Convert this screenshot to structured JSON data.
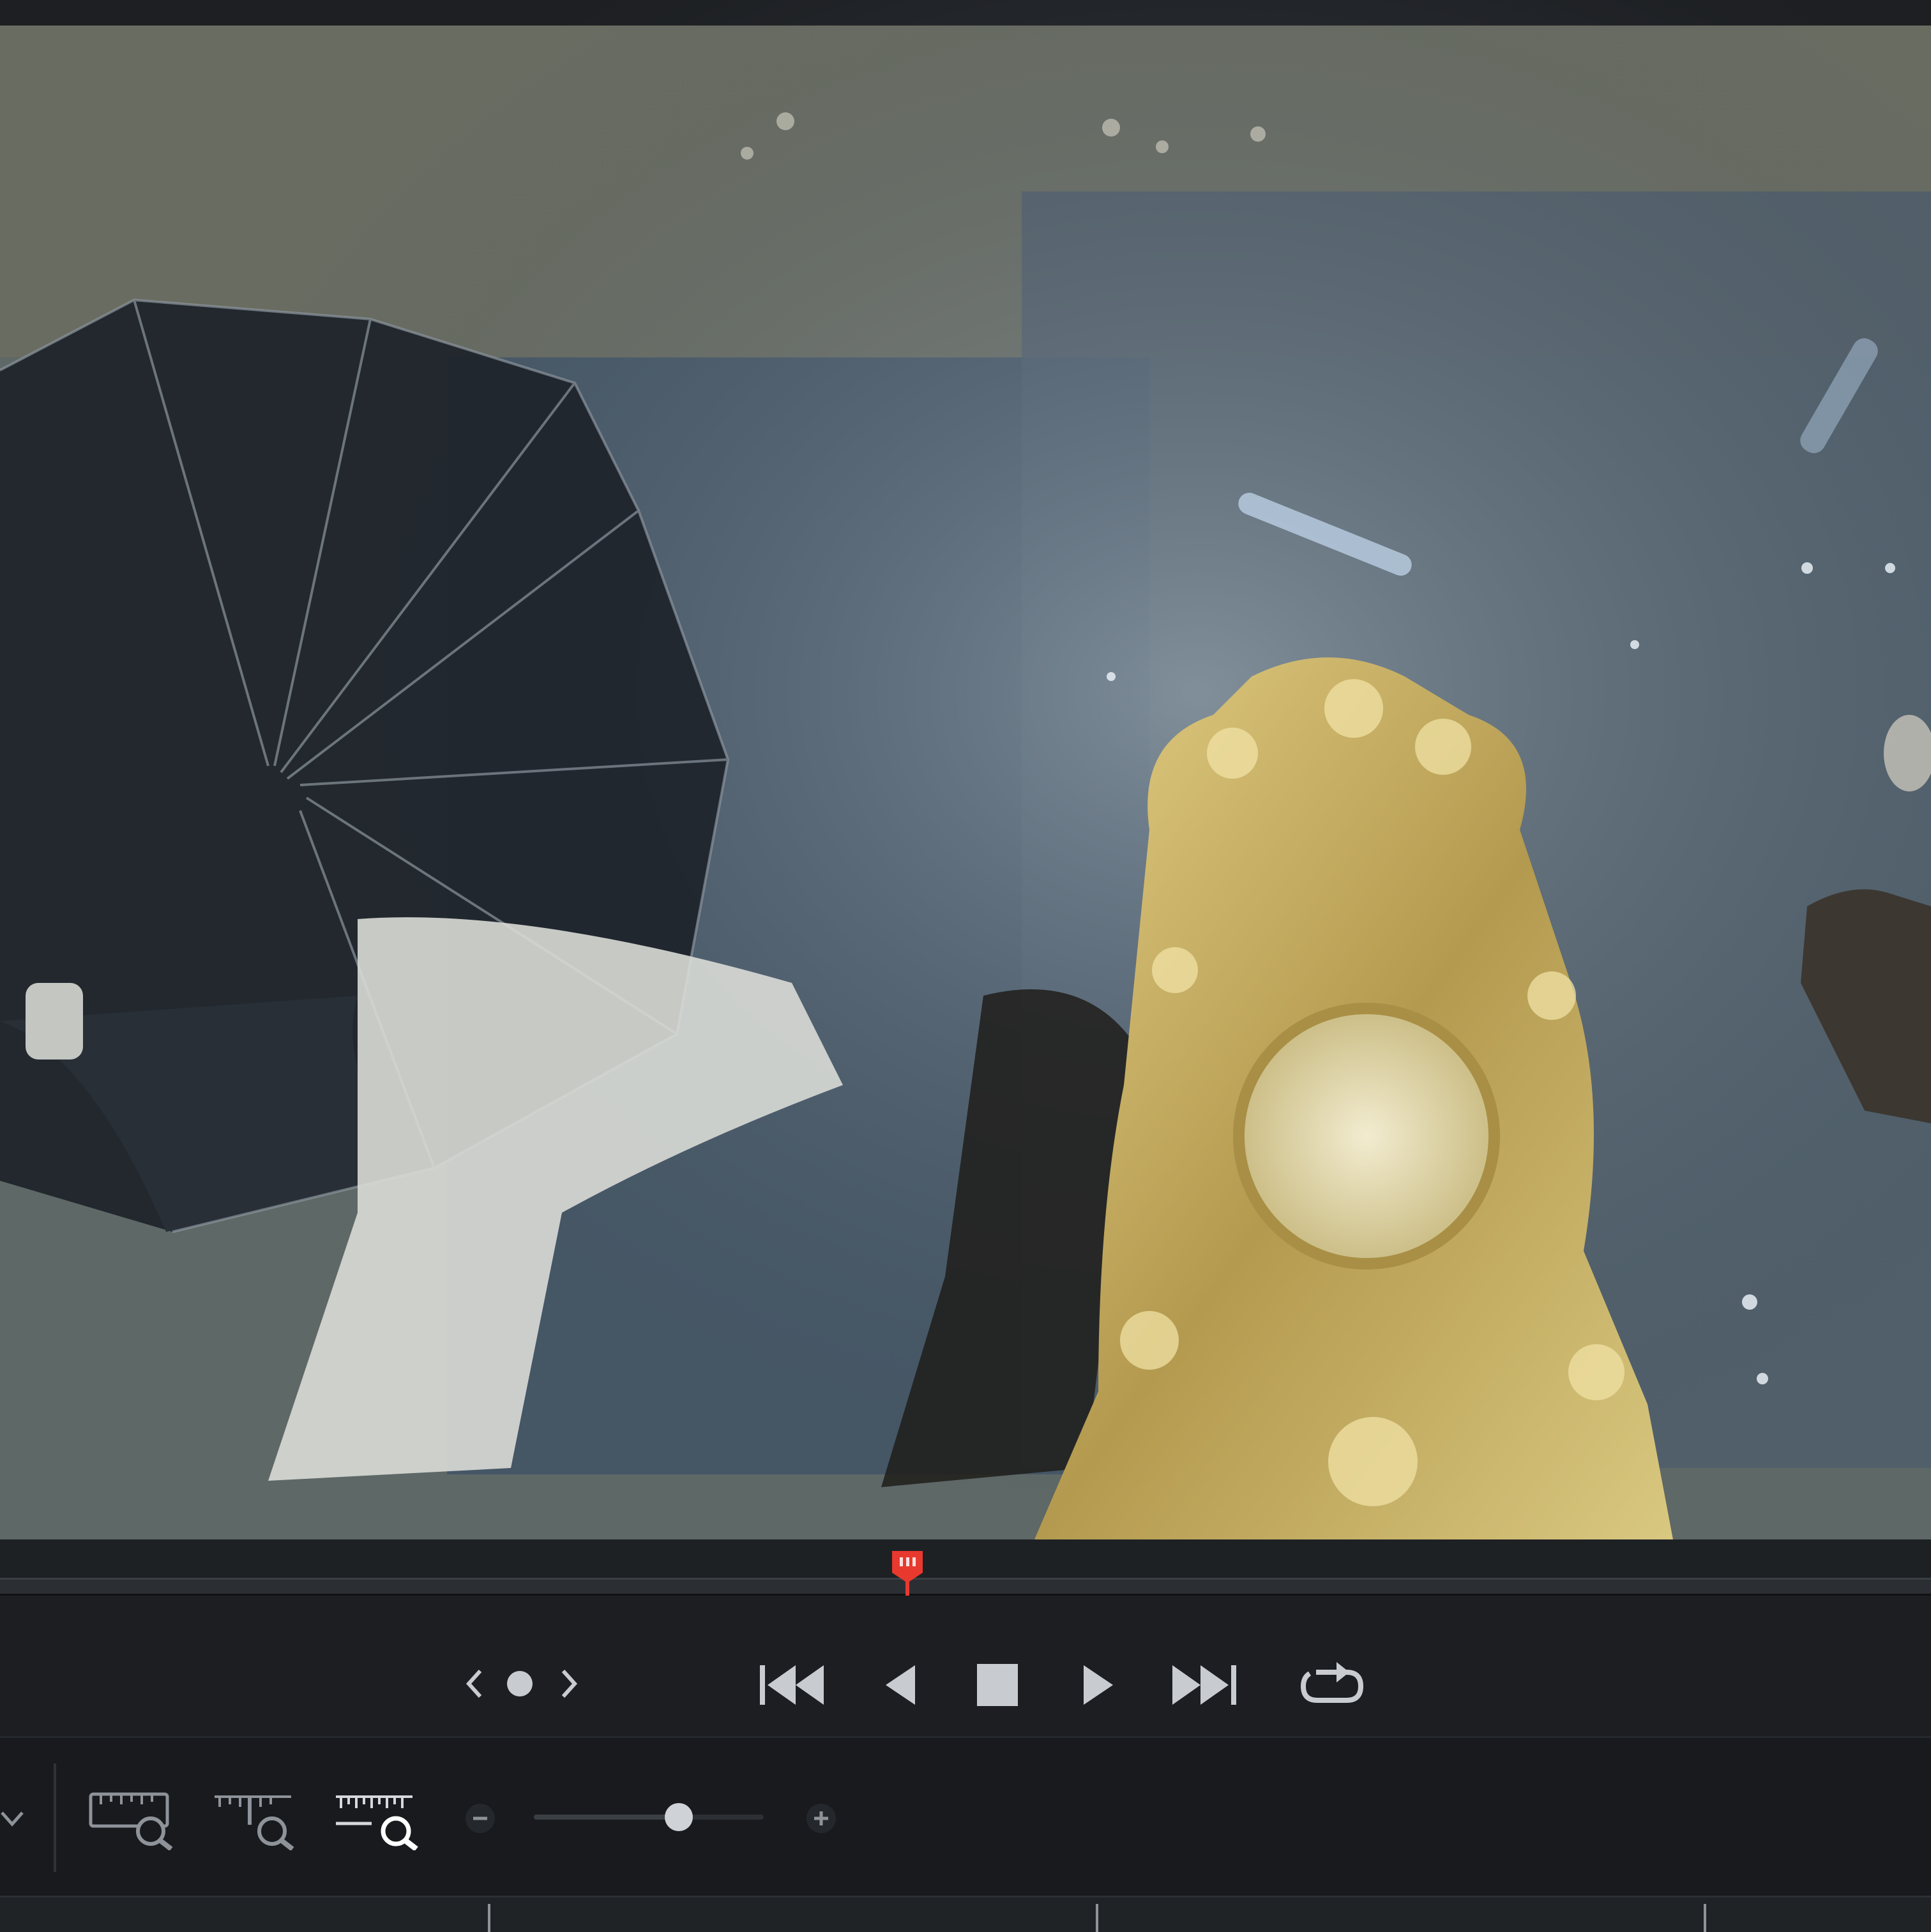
{
  "viewer": {
    "content": "video-frame",
    "colors": {
      "frame_top": "#6e6f63",
      "frame_mid": "#56626d",
      "gold": "#c9b46a",
      "umbrella": "#1f252c"
    }
  },
  "scrubber": {
    "playhead_color": "#e8392f",
    "position_fraction": 0.47
  },
  "transport": {
    "buttons": [
      {
        "id": "prev-marker",
        "icon": "chevron-left-icon"
      },
      {
        "id": "add-marker",
        "icon": "dot-icon"
      },
      {
        "id": "next-marker",
        "icon": "chevron-right-icon"
      },
      {
        "id": "go-to-start",
        "icon": "skip-start-icon"
      },
      {
        "id": "play-reverse",
        "icon": "play-reverse-icon"
      },
      {
        "id": "stop",
        "icon": "stop-icon"
      },
      {
        "id": "play",
        "icon": "play-icon"
      },
      {
        "id": "go-to-end",
        "icon": "skip-end-icon"
      },
      {
        "id": "loop",
        "icon": "loop-icon"
      }
    ],
    "icon_color": "#c8ccd1"
  },
  "zoombar": {
    "tools": [
      {
        "id": "zoom-full",
        "icon": "ruler-zoom-full-icon"
      },
      {
        "id": "zoom-detail",
        "icon": "ruler-zoom-detail-icon"
      },
      {
        "id": "zoom-custom",
        "icon": "ruler-zoom-custom-icon"
      }
    ],
    "zoom_level_fraction": 0.63,
    "minus_icon": "minus-icon",
    "plus_icon": "plus-icon",
    "dropdown_icon": "chevron-down-icon"
  }
}
